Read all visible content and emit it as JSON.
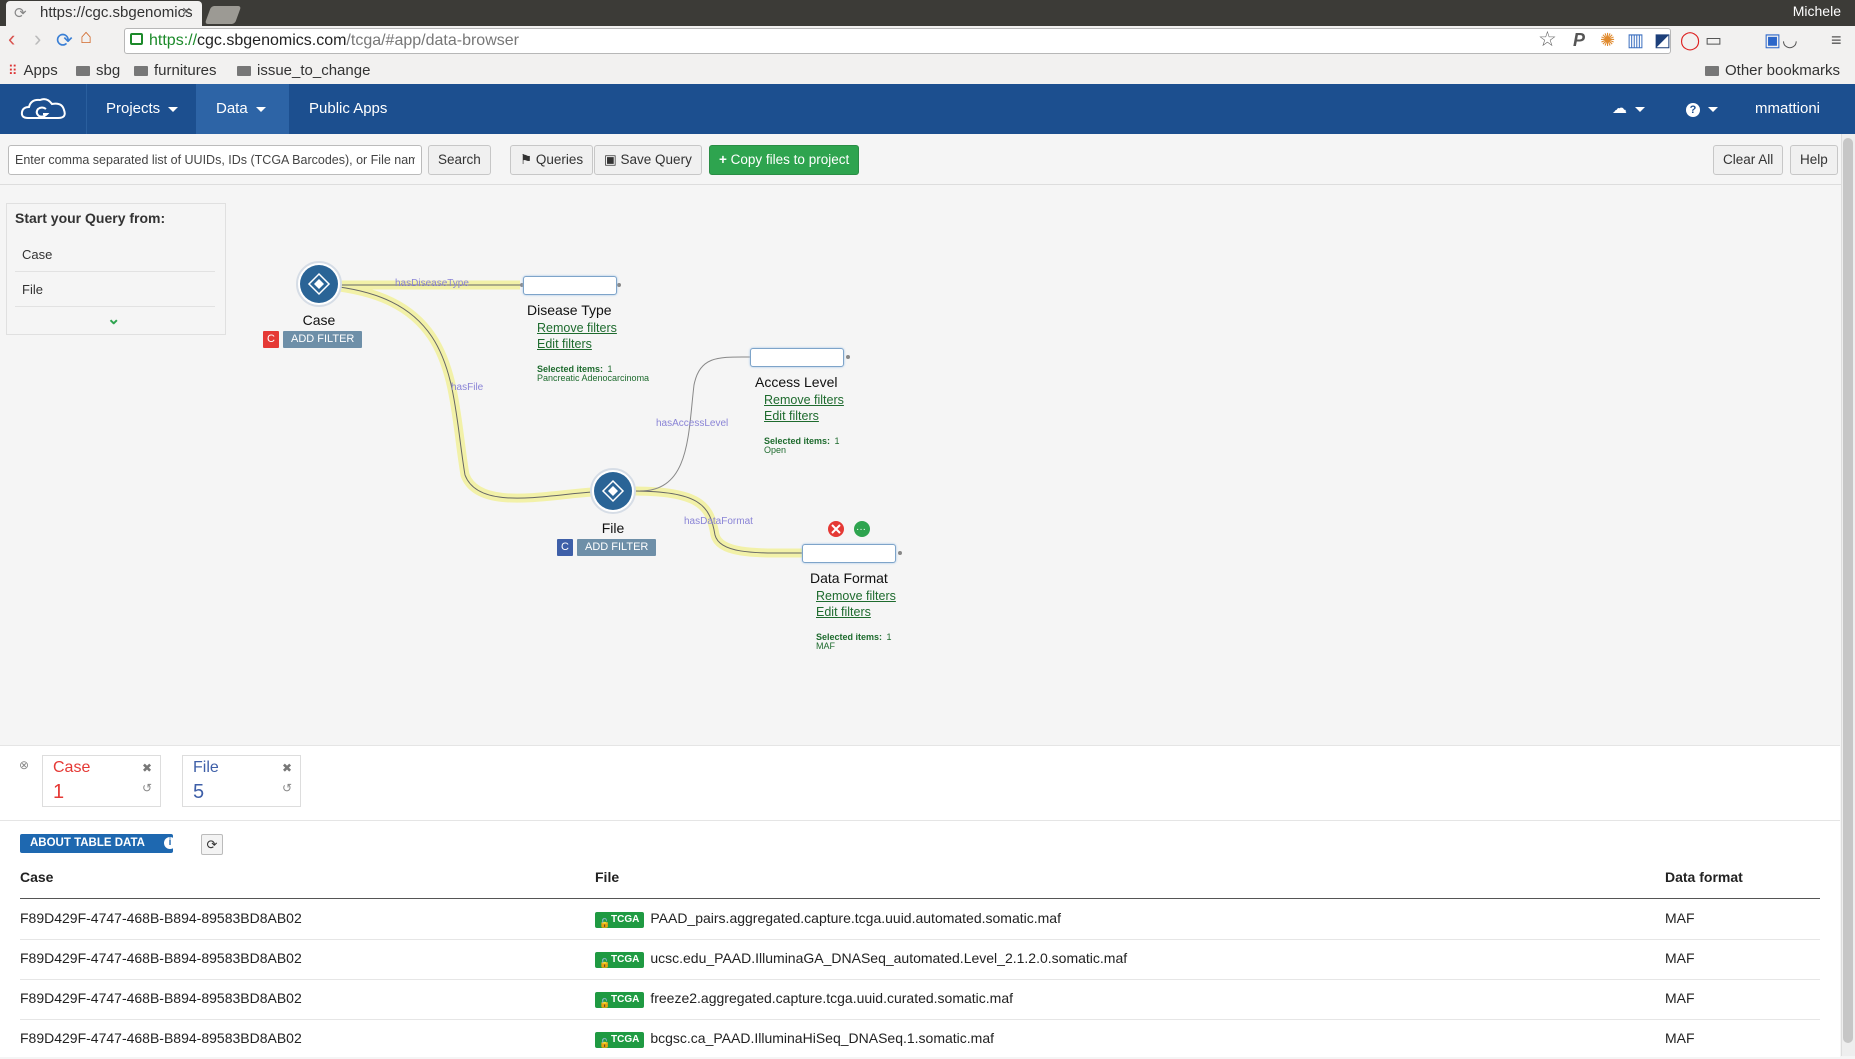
{
  "browser": {
    "tab_title": "https://cgc.sbgenomics",
    "user": "Michele",
    "url_https": "https://",
    "url_host": "cgc.sbgenomics.com",
    "url_path": "/tcga/#app/data-browser",
    "bookmarks": {
      "apps": "Apps",
      "b1": "sbg",
      "b2": "furnitures",
      "b3": "issue_to_change",
      "other": "Other bookmarks"
    }
  },
  "header": {
    "nav": {
      "projects": "Projects",
      "data": "Data",
      "public_apps": "Public Apps"
    },
    "user": "mmattioni"
  },
  "toolbar": {
    "search_value": "Enter comma separated list of UUIDs, IDs (TCGA Barcodes), or File names",
    "search_btn": "Search",
    "queries_btn": "Queries",
    "save_btn": "Save Query",
    "copy_btn": "Copy files to project",
    "clear_btn": "Clear All",
    "help_btn": "Help"
  },
  "query_panel": {
    "title": "Start your Query from:",
    "items": [
      "Case",
      "File"
    ]
  },
  "graph": {
    "nodes": {
      "case": {
        "label": "Case",
        "badge": "C",
        "add_filter": "ADD FILTER"
      },
      "file": {
        "label": "File",
        "badge": "C",
        "add_filter": "ADD FILTER"
      }
    },
    "edges": {
      "disease": "hasDiseaseType",
      "file": "hasFile",
      "access": "hasAccessLevel",
      "format": "hasDataFormat"
    },
    "properties": {
      "disease": {
        "title": "Disease Type",
        "remove": "Remove filters",
        "edit": "Edit filters",
        "sel_label": "Selected items:",
        "sel_count": "1",
        "value": "Pancreatic Adenocarcinoma"
      },
      "access": {
        "title": "Access Level",
        "remove": "Remove filters",
        "edit": "Edit filters",
        "sel_label": "Selected items:",
        "sel_count": "1",
        "value": "Open"
      },
      "format": {
        "title": "Data Format",
        "remove": "Remove filters",
        "edit": "Edit filters",
        "sel_label": "Selected items:",
        "sel_count": "1",
        "value": "MAF"
      }
    }
  },
  "counters": [
    {
      "title": "Case",
      "value": "1",
      "color": "#e53935"
    },
    {
      "title": "File",
      "value": "5",
      "color": "#3e5fa8"
    }
  ],
  "table": {
    "about_btn": "ABOUT TABLE DATA",
    "headers": {
      "case": "Case",
      "file": "File",
      "format": "Data format"
    },
    "tag": "TCGA",
    "rows": [
      {
        "case": "F89D429F-4747-468B-B894-89583BD8AB02",
        "file": "PAAD_pairs.aggregated.capture.tcga.uuid.automated.somatic.maf",
        "format": "MAF"
      },
      {
        "case": "F89D429F-4747-468B-B894-89583BD8AB02",
        "file": "ucsc.edu_PAAD.IlluminaGA_DNASeq_automated.Level_2.1.2.0.somatic.maf",
        "format": "MAF"
      },
      {
        "case": "F89D429F-4747-468B-B894-89583BD8AB02",
        "file": "freeze2.aggregated.capture.tcga.uuid.curated.somatic.maf",
        "format": "MAF"
      },
      {
        "case": "F89D429F-4747-468B-B894-89583BD8AB02",
        "file": "bcgsc.ca_PAAD.IlluminaHiSeq_DNASeq.1.somatic.maf",
        "format": "MAF"
      }
    ]
  },
  "colors": {
    "brand": "#1c4f8f",
    "success": "#2ea44f",
    "node": "#2a6496",
    "edge_highlight": "#f2f1a8"
  }
}
